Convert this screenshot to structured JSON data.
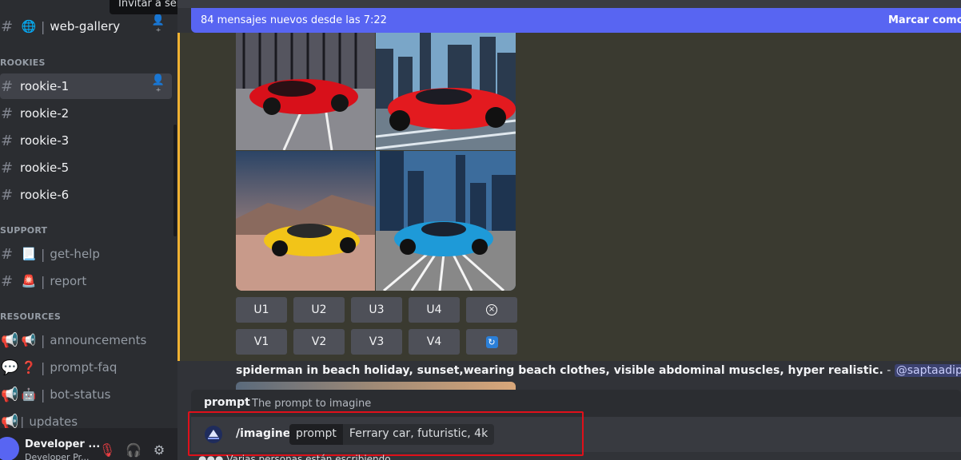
{
  "sidebar": {
    "tooltip": "Invitar a servidor",
    "top_channel": {
      "name": "web-gallery",
      "emoji": "🌐"
    },
    "categories": [
      {
        "title": "ROOKIES",
        "channels": [
          {
            "name": "rookie-1"
          },
          {
            "name": "rookie-2"
          },
          {
            "name": "rookie-3"
          },
          {
            "name": "rookie-5"
          },
          {
            "name": "rookie-6"
          }
        ]
      },
      {
        "title": "SUPPORT",
        "channels": [
          {
            "name": "get-help",
            "emoji": "📃"
          },
          {
            "name": "report",
            "emoji": "🚨"
          }
        ]
      },
      {
        "title": "RESOURCES",
        "channels": [
          {
            "name": "announcements",
            "emoji": "📢"
          },
          {
            "name": "prompt-faq",
            "emoji": "❓"
          },
          {
            "name": "bot-status",
            "emoji": "🤖"
          },
          {
            "name": "updates"
          }
        ]
      }
    ],
    "user": {
      "name": "Developer ...",
      "status": "Developer Pr..."
    }
  },
  "main": {
    "new_messages_text": "84 mensajes nuevos desde las 7:22",
    "mark_read": "Marcar como le",
    "upscale_buttons": [
      "U1",
      "U2",
      "U3",
      "U4"
    ],
    "variation_buttons": [
      "V1",
      "V2",
      "V3",
      "V4"
    ],
    "message": {
      "text": "spiderman in beach holiday, sunset,wearing beach clothes, visible abdominal muscles, hyper realistic.",
      "dash": " - ",
      "mention": "@saptaadiputra"
    },
    "autocomplete": {
      "option": "prompt",
      "description": "The prompt to imagine"
    },
    "composer": {
      "command": "/imagine",
      "param_name": "prompt",
      "param_value": "Ferrary car, futuristic, 4k"
    },
    "typing": "Varias personas están escribiendo..."
  }
}
